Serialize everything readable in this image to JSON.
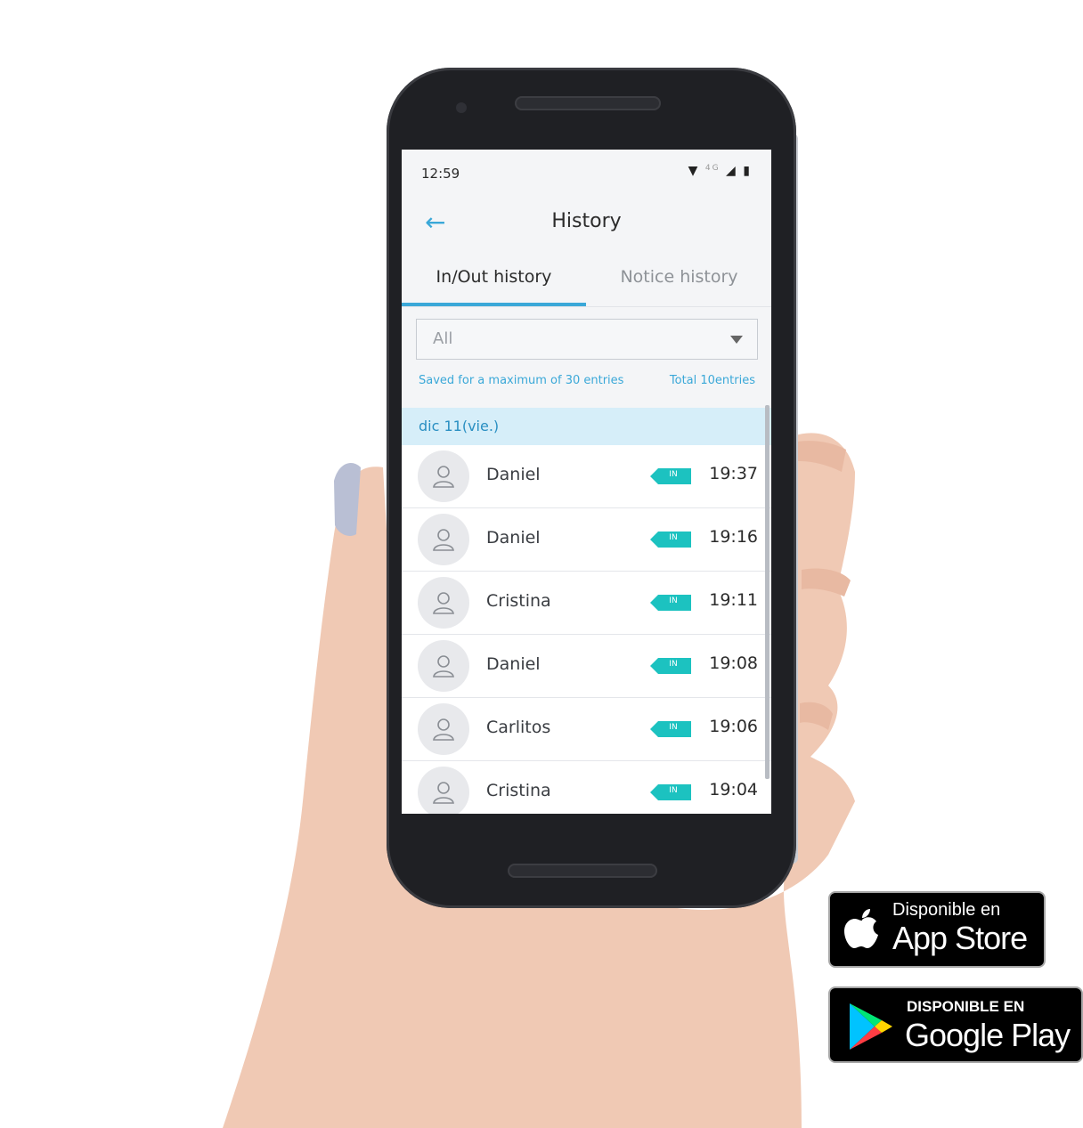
{
  "status_bar": {
    "time": "12:59",
    "network": "4G"
  },
  "app_bar": {
    "title": "History",
    "back_icon": "arrow-left-icon"
  },
  "tabs": [
    {
      "label": "In/Out history",
      "active": true
    },
    {
      "label": "Notice history",
      "active": false
    }
  ],
  "filter": {
    "selected": "All"
  },
  "info": {
    "left": "Saved for a maximum of 30 entries",
    "right": "Total 10entries"
  },
  "day_header": "dic 11(vie.)",
  "entries": [
    {
      "name": "Daniel",
      "badge": "IN",
      "time": "19:37"
    },
    {
      "name": "Daniel",
      "badge": "IN",
      "time": "19:16"
    },
    {
      "name": "Cristina",
      "badge": "IN",
      "time": "19:11"
    },
    {
      "name": "Daniel",
      "badge": "IN",
      "time": "19:08"
    },
    {
      "name": "Carlitos",
      "badge": "IN",
      "time": "19:06"
    },
    {
      "name": "Cristina",
      "badge": "IN",
      "time": "19:04"
    }
  ],
  "badges": {
    "app_store": {
      "small": "Disponible en",
      "big": "App Store"
    },
    "google_play": {
      "small": "DISPONIBLE EN",
      "big": "Google Play"
    }
  },
  "colors": {
    "accent": "#3aa8d8",
    "in_badge": "#1cc2c0",
    "day_header_bg": "#d6eef9"
  }
}
